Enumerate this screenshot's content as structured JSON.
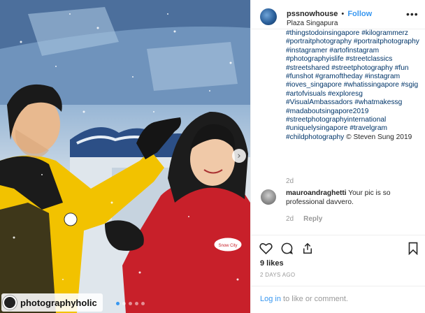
{
  "post": {
    "username": "pssnowhouse",
    "separator": "•",
    "follow_label": "Follow",
    "location": "Plaza Singapura",
    "more_icon": "ellipsis-icon",
    "caption_top": "#thingstodoinsingapore",
    "caption_tags": "#kilogrammerz #portraitphotography #portraitphotography #instagramer #artofinstagram #photographyislife #streetclassics #streetshared #streetphotography #fun #funshot #gramoftheday #instagram #ioves_singapore #whatissingapore #sgig #artofvisuals #exploresg #VisualAmbassadors #whatmakessg #madaboutsingapore2019 #streetphotographyinternational #uniquelysingapore #travelgram #childphotography",
    "caption_credit": "© Steven Sung 2019",
    "caption_time": "2d",
    "likes": "9 likes",
    "time_ago": "2 DAYS AGO",
    "login_link": "Log in",
    "login_rest": " to like or comment."
  },
  "comment": {
    "username": "mauroandraghetti",
    "text": "Your pic is so professional davvero.",
    "time": "2d",
    "reply_label": "Reply"
  },
  "photo": {
    "watermark": "photographyholic",
    "jacket_badge": "Snow City",
    "carousel_dots": 5,
    "active_dot": 0
  },
  "colors": {
    "accent": "#3897f0",
    "hashtag": "#003569",
    "muted": "#999999",
    "jacket_yellow": "#f2c200",
    "jacket_red": "#c8202a"
  }
}
